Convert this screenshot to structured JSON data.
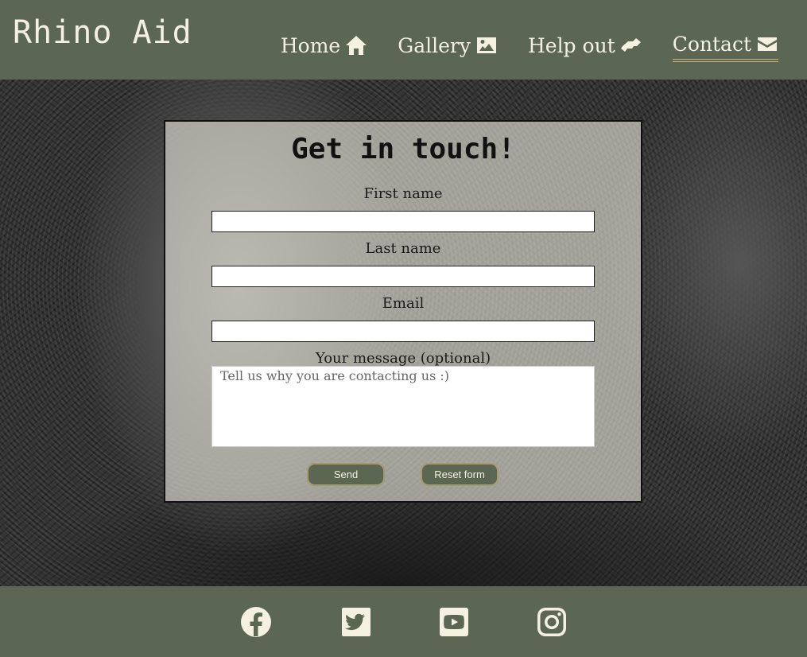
{
  "header": {
    "logo": "Rhino Aid",
    "nav": [
      {
        "label": "Home",
        "icon": "home-icon"
      },
      {
        "label": "Gallery",
        "icon": "image-icon"
      },
      {
        "label": "Help out",
        "icon": "hands-helping-icon"
      },
      {
        "label": "Contact",
        "icon": "envelope-icon",
        "active": true
      }
    ]
  },
  "form": {
    "title": "Get in touch!",
    "first_name_label": "First name",
    "last_name_label": "Last name",
    "email_label": "Email",
    "message_label": "Your message (optional)",
    "message_placeholder": "Tell us why you are contacting us :)",
    "send_label": "Send",
    "reset_label": "Reset form"
  },
  "footer": {
    "social": [
      "facebook-icon",
      "twitter-icon",
      "youtube-icon",
      "instagram-icon"
    ]
  },
  "colors": {
    "brand": "#5b6653",
    "text_light": "#f4f1e1",
    "accent": "#c9b07a"
  }
}
